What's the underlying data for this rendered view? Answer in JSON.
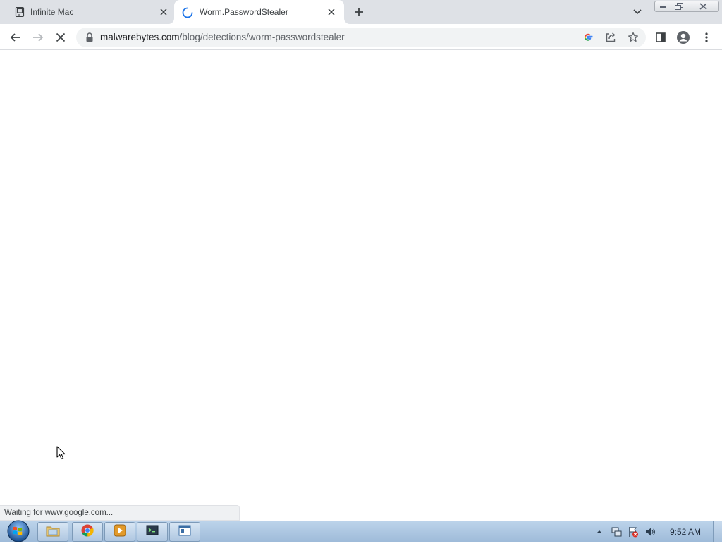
{
  "browser": {
    "tabs": [
      {
        "title": "Infinite Mac",
        "active": false,
        "icon": "classic-mac-icon"
      },
      {
        "title": "Worm.PasswordStealer",
        "active": true,
        "icon": "loading-spinner-icon"
      }
    ],
    "address_bar": {
      "domain": "malwarebytes.com",
      "path": "/blog/detections/worm-passwordstealer"
    },
    "status_text": "Waiting for www.google.com...",
    "accent_color": "#1a73e8"
  },
  "taskbar": {
    "apps": [
      "file-explorer-icon",
      "chrome-icon",
      "media-player-icon",
      "terminal-icon",
      "window-icon"
    ],
    "clock": "9:52 AM"
  }
}
